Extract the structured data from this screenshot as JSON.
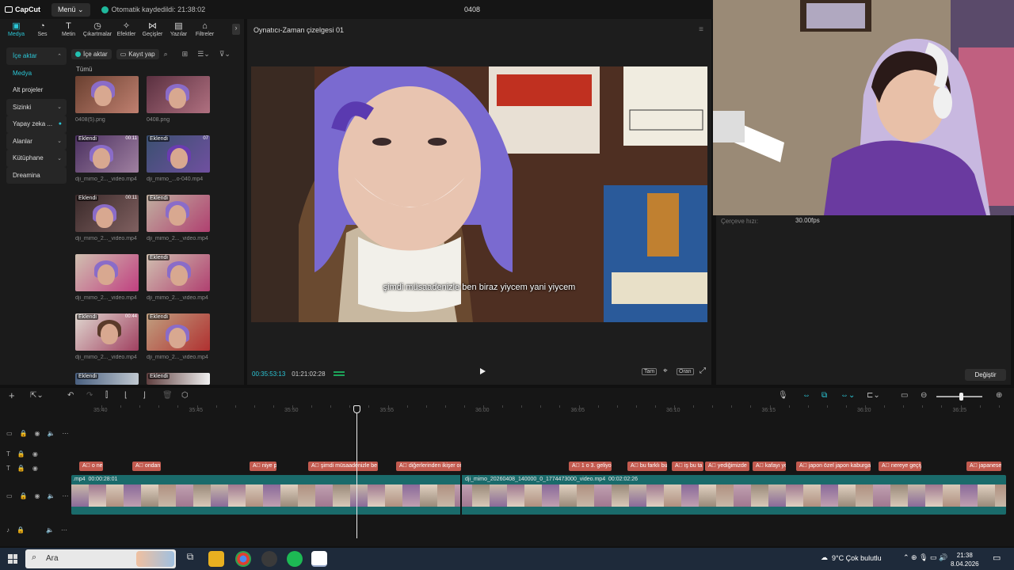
{
  "titlebar": {
    "app_name": "CapCut",
    "menu_label": "Menü",
    "autosave_text": "Otomatik kaydedildi: 21:38:02",
    "project_name": "0408"
  },
  "category_tabs": [
    {
      "label": "Medya",
      "icon": "media-icon"
    },
    {
      "label": "Ses",
      "icon": "audio-icon"
    },
    {
      "label": "Metin",
      "icon": "text-icon"
    },
    {
      "label": "Çıkartmalar",
      "icon": "sticker-icon"
    },
    {
      "label": "Efektler",
      "icon": "effects-icon"
    },
    {
      "label": "Geçişler",
      "icon": "transitions-icon"
    },
    {
      "label": "Yazılar",
      "icon": "captions-icon"
    },
    {
      "label": "Filtreler",
      "icon": "filters-icon"
    }
  ],
  "sidebar": {
    "items": [
      {
        "label": "İçe aktar",
        "chevron": true
      },
      {
        "label": "Medya",
        "chevron": false
      },
      {
        "label": "Alt projeler",
        "chevron": false
      },
      {
        "label": "Sizinki",
        "chevron": true
      },
      {
        "label": "Yapay zeka ...",
        "chevron": true
      },
      {
        "label": "Alanlar",
        "chevron": true
      },
      {
        "label": "Kütüphane",
        "chevron": true
      },
      {
        "label": "Dreamina",
        "chevron": false
      }
    ]
  },
  "media": {
    "import_label": "İçe aktar",
    "record_label": "Kayıt yap",
    "filter_all": "Tümü",
    "items": [
      {
        "caption": "0408(5).png",
        "badge": "",
        "duration": ""
      },
      {
        "caption": "0408.png",
        "badge": "",
        "duration": ""
      },
      {
        "caption": "dji_mimo_2..._video.mp4",
        "badge": "Eklendi",
        "duration": "00:11"
      },
      {
        "caption": "dji_mimo_...o-040.mp4",
        "badge": "Eklendi",
        "duration": "07"
      },
      {
        "caption": "dji_mimo_2..._video.mp4",
        "badge": "Eklendi",
        "duration": "00:11"
      },
      {
        "caption": "dji_mimo_2..._video.mp4",
        "badge": "Eklendi",
        "duration": ""
      },
      {
        "caption": "dji_mimo_2..._video.mp4",
        "badge": "Eklendi",
        "duration": ""
      },
      {
        "caption": "dji_mimo_2..._video.mp4",
        "badge": "Eklendi",
        "duration": ""
      },
      {
        "caption": "dji_mimo_2..._video.mp4",
        "badge": "Eklendi",
        "duration": "00:44"
      },
      {
        "caption": "dji_mimo_2..._video.mp4",
        "badge": "Eklendi",
        "duration": ""
      },
      {
        "caption": "",
        "badge": "Eklendi",
        "duration": ""
      },
      {
        "caption": "",
        "badge": "Eklendi",
        "duration": ""
      }
    ]
  },
  "player": {
    "title": "Oynatıcı-Zaman çizelgesi 01",
    "subtitle": "şimdi müsaadenizle ben biraz yiycem yani yiycem",
    "current_time": "00:35:53:13",
    "total_time": "01:21:02:28",
    "full_label": "Tam",
    "ratio_label": "Oran"
  },
  "details": {
    "frame_rate_label": "Çerçeve hızı:",
    "frame_rate_value": "30.00fps",
    "change_button": "Değiştir"
  },
  "timeline": {
    "ruler_labels": [
      "35:40",
      "35:45",
      "35:50",
      "35:55",
      "36:00",
      "36:05",
      "36:10",
      "36:15",
      "36:20",
      "36:25"
    ],
    "subtitle_clips": [
      "o ne",
      "ondan",
      "niye p",
      "şimdi müsaadenizle be",
      "diğerlerinden ikişer on",
      "1 o 3. geliyo",
      "bu farklı bu",
      "iş bu ta",
      "yediğimizde",
      "kafayı ye",
      "japon özel japon kaburga",
      "nereye geçiy",
      "japanese"
    ],
    "video_clips": [
      {
        "name": ".mp4",
        "duration": "00:00:28:01"
      },
      {
        "name": "dji_mimo_20260408_140000_0_1774473000_video.mp4",
        "duration": "00:02:02:26"
      }
    ]
  },
  "taskbar": {
    "search_placeholder": "Ara",
    "weather": "9°C  Çok bulutlu",
    "time": "21:38",
    "date": "8.04.2026"
  },
  "colors": {
    "accent": "#2bc6d6",
    "subtitle_clip": "#c25a4f",
    "video_track": "#1a6b6b"
  }
}
